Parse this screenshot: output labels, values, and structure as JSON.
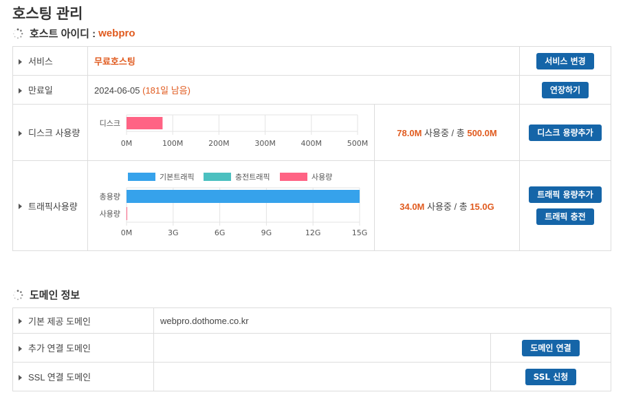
{
  "page_title": "호스팅 관리",
  "host_section": {
    "label": "호스트 아이디 :",
    "host_id": "webpro"
  },
  "hosting_table": {
    "service": {
      "label": "서비스",
      "value": "무료호스팅",
      "button": "서비스 변경"
    },
    "expiry": {
      "label": "만료일",
      "date": "2024-06-05",
      "remaining": "(181일 남음)",
      "button": "연장하기"
    },
    "disk": {
      "label": "디스크 사용량",
      "used_value": "78.0M",
      "used_text": "사용중 / 총",
      "total_value": "500.0M",
      "button": "디스크 용량추가"
    },
    "traffic": {
      "label": "트래픽사용량",
      "used_value": "34.0M",
      "used_text": "사용중 / 총",
      "total_value": "15.0G",
      "button_add": "트래픽 용량추가",
      "button_charge": "트래픽 충전"
    }
  },
  "chart_data": [
    {
      "type": "bar",
      "orientation": "horizontal",
      "categories": [
        "디스크"
      ],
      "values": [
        78
      ],
      "unit": "M",
      "xlim": [
        0,
        500
      ],
      "tick_labels": [
        "0M",
        "100M",
        "200M",
        "300M",
        "400M",
        "500M"
      ],
      "colors": [
        "#ff6384"
      ]
    },
    {
      "type": "bar",
      "orientation": "horizontal",
      "categories": [
        "총용량",
        "사용량"
      ],
      "legend": [
        "기본트래픽",
        "충전트래픽",
        "사용량"
      ],
      "legend_colors": [
        "#36a2eb",
        "#4bc0c0",
        "#ff6384"
      ],
      "values": [
        15,
        0.034
      ],
      "unit": "G",
      "xlim": [
        0,
        15
      ],
      "tick_labels": [
        "0M",
        "3G",
        "6G",
        "9G",
        "12G",
        "15G"
      ],
      "colors": [
        "#36a2eb",
        "#ff6384"
      ]
    }
  ],
  "domain_section": {
    "title": "도메인 정보",
    "rows": [
      {
        "label": "기본 제공 도메인",
        "value": "webpro.dothome.co.kr"
      },
      {
        "label": "추가 연결 도메인",
        "value": "",
        "button": "도메인 연결"
      },
      {
        "label": "SSL 연결 도메인",
        "value": "",
        "button": "SSL 신청"
      }
    ]
  },
  "colors": {
    "accent": "#e05a1e",
    "button": "#1565a8",
    "border": "#dcdcdc"
  }
}
